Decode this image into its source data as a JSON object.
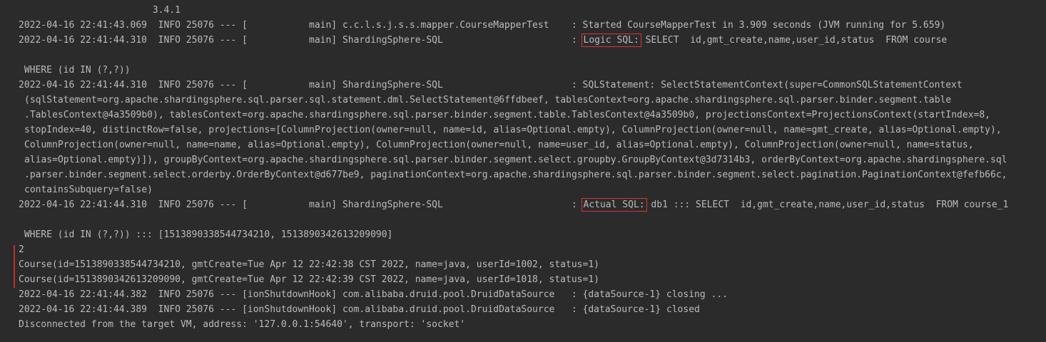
{
  "console": {
    "lines": [
      {
        "text": "                        3.4.1"
      },
      {
        "text": "2022-04-16 22:41:43.069  INFO 25076 --- [           main] c.c.l.s.j.s.s.mapper.CourseMapperTest    : Started CourseMapperTest in 3.909 seconds (JVM running for 5.659)"
      },
      {
        "prefix": "2022-04-16 22:41:44.310  INFO 25076 --- [           main] ShardingSphere-SQL                       : ",
        "highlight": "Logic SQL:",
        "suffix": " SELECT  id,gmt_create,name,user_id,status  FROM course"
      },
      {
        "text": ""
      },
      {
        "text": " WHERE (id IN (?,?))"
      },
      {
        "text": "2022-04-16 22:41:44.310  INFO 25076 --- [           main] ShardingSphere-SQL                       : SQLStatement: SelectStatementContext(super=CommonSQLStatementContext"
      },
      {
        "text": "(sqlStatement=org.apache.shardingsphere.sql.parser.sql.statement.dml.SelectStatement@6ffdbeef, tablesContext=org.apache.shardingsphere.sql.parser.binder.segment.table"
      },
      {
        "text": ".TablesContext@4a3509b0), tablesContext=org.apache.shardingsphere.sql.parser.binder.segment.table.TablesContext@4a3509b0, projectionsContext=ProjectionsContext(startIndex=8,"
      },
      {
        "text": "stopIndex=40, distinctRow=false, projections=[ColumnProjection(owner=null, name=id, alias=Optional.empty), ColumnProjection(owner=null, name=gmt_create, alias=Optional.empty),"
      },
      {
        "text": "ColumnProjection(owner=null, name=name, alias=Optional.empty), ColumnProjection(owner=null, name=user_id, alias=Optional.empty), ColumnProjection(owner=null, name=status,"
      },
      {
        "text": "alias=Optional.empty)]), groupByContext=org.apache.shardingsphere.sql.parser.binder.segment.select.groupby.GroupByContext@3d7314b3, orderByContext=org.apache.shardingsphere.sql"
      },
      {
        "text": ".parser.binder.segment.select.orderby.OrderByContext@d677be9, paginationContext=org.apache.shardingsphere.sql.parser.binder.segment.select.pagination.PaginationContext@fefb66c,"
      },
      {
        "text": "containsSubquery=false)"
      },
      {
        "prefix": "2022-04-16 22:41:44.310  INFO 25076 --- [           main] ShardingSphere-SQL                       : ",
        "highlight": "Actual SQL:",
        "suffix": " db1 ::: SELECT  id,gmt_create,name,user_id,status  FROM course_1"
      },
      {
        "text": ""
      },
      {
        "text": " WHERE (id IN (?,?)) ::: [1513890338544734210, 1513890342613209090]"
      },
      {
        "text": "2"
      },
      {
        "text": "Course(id=1513890338544734210, gmtCreate=Tue Apr 12 22:42:38 CST 2022, name=java, userId=1002, status=1)"
      },
      {
        "text": "Course(id=1513890342613209090, gmtCreate=Tue Apr 12 22:42:39 CST 2022, name=java, userId=1018, status=1)"
      },
      {
        "text": "2022-04-16 22:41:44.382  INFO 25076 --- [ionShutdownHook] com.alibaba.druid.pool.DruidDataSource   : {dataSource-1} closing ..."
      },
      {
        "text": "2022-04-16 22:41:44.389  INFO 25076 --- [ionShutdownHook] com.alibaba.druid.pool.DruidDataSource   : {dataSource-1} closed"
      },
      {
        "text": "Disconnected from the target VM, address: '127.0.0.1:54640', transport: 'socket'"
      }
    ]
  },
  "colors": {
    "background": "#2b2b2b",
    "text": "#bbbbbb",
    "highlight_border": "#e03232"
  }
}
